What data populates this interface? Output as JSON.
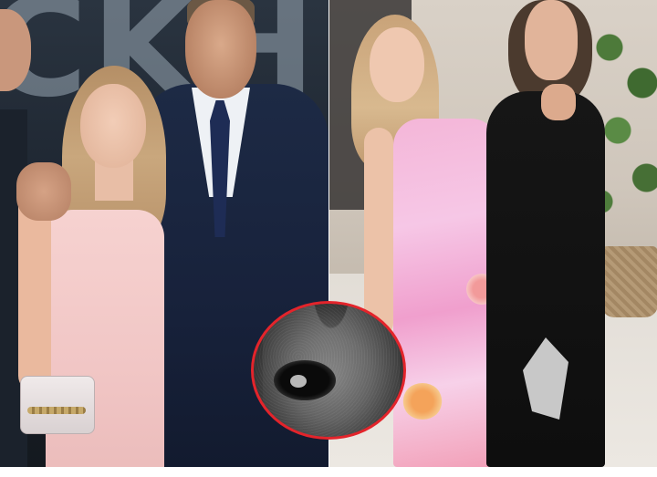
{
  "image": {
    "backdrop_text": "CKH",
    "colors": {
      "inset_border": "#e3242b",
      "pink_dress": "#f1c6c5",
      "floral_dress": "#f4b6d8",
      "suit": "#17213a",
      "black_dress": "#0e0e0e"
    }
  }
}
